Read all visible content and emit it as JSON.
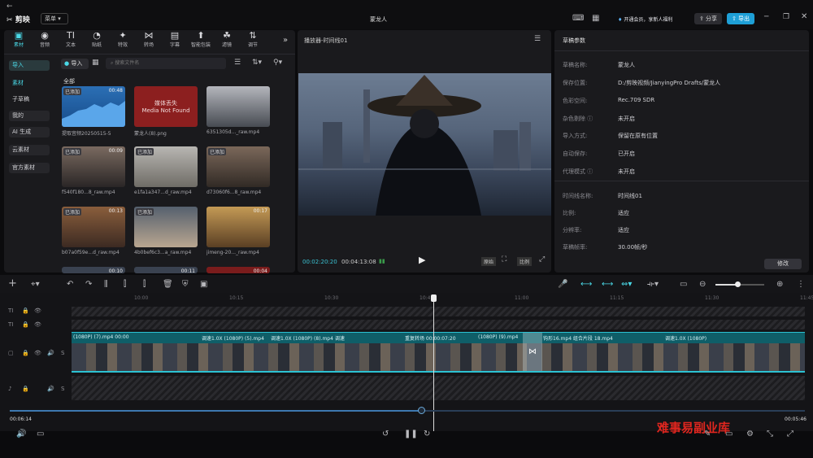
{
  "app": {
    "name": "剪映",
    "menu": "菜单",
    "project_title": "蒙龙人",
    "vip": "开通会员，享新人福利",
    "share": "分享",
    "export": "导出"
  },
  "toolbar": {
    "items": [
      {
        "label": "素材",
        "glyph": "▣"
      },
      {
        "label": "音频",
        "glyph": "◉"
      },
      {
        "label": "文本",
        "glyph": "TI"
      },
      {
        "label": "贴纸",
        "glyph": "◔"
      },
      {
        "label": "特效",
        "glyph": "✦"
      },
      {
        "label": "转场",
        "glyph": "⋈"
      },
      {
        "label": "字幕",
        "glyph": "▤"
      },
      {
        "label": "智能包装",
        "glyph": "⬆"
      },
      {
        "label": "滤镜",
        "glyph": "☘"
      },
      {
        "label": "调节",
        "glyph": "⇅"
      }
    ],
    "more": "»"
  },
  "sidebar": {
    "items": [
      "导入",
      "素材",
      "子草稿",
      "我的",
      "AI 生成",
      "云素材",
      "官方素材"
    ]
  },
  "media": {
    "import_label": "导入",
    "search_placeholder": "搜索文件名",
    "section": "全部",
    "items": [
      {
        "badge": "已添加",
        "dur": "00:48",
        "name": "提取音频20250515-5"
      },
      {
        "badge": "",
        "dur": "",
        "name": "蒙龙人(8).png",
        "missing_line1": "媒体丢失",
        "missing_line2": "Media Not Found"
      },
      {
        "badge": "",
        "dur": "",
        "name": "6351305d..._raw.mp4"
      },
      {
        "badge": "已添加",
        "dur": "00:09",
        "name": "f540f180...8_raw.mp4"
      },
      {
        "badge": "已添加",
        "dur": "",
        "name": "e1fa1a347...d_raw.mp4"
      },
      {
        "badge": "已添加",
        "dur": "",
        "name": "d73060f6...8_raw.mp4"
      },
      {
        "badge": "已添加",
        "dur": "00:13",
        "name": "b07a0f59e...d_raw.mp4"
      },
      {
        "badge": "已添加",
        "dur": "",
        "name": "4b0bef6c3...a_raw.mp4"
      },
      {
        "badge": "",
        "dur": "00:17",
        "name": "jimeng-20..._raw.mp4"
      },
      {
        "badge": "",
        "dur": "00:10",
        "name": ""
      },
      {
        "badge": "",
        "dur": "00:11",
        "name": ""
      },
      {
        "badge": "",
        "dur": "00:04",
        "name": ""
      }
    ]
  },
  "player": {
    "title": "播放器-时间线01",
    "current": "00:02:20:20",
    "total": "00:04:13:08",
    "ratio": "比例",
    "original": "原始"
  },
  "props": {
    "title": "草稿参数",
    "rows": [
      {
        "label": "草稿名称:",
        "value": "蒙龙人"
      },
      {
        "label": "保存位置:",
        "value": "D:/剪映视频/JianyingPro Drafts/蒙龙人"
      },
      {
        "label": "色彩空间:",
        "value": "Rec.709 SDR"
      },
      {
        "label": "杂色剔除 ⓘ",
        "value": "未开启"
      },
      {
        "label": "导入方式:",
        "value": "保留在原有位置"
      },
      {
        "label": "自动保存:",
        "value": "已开启"
      },
      {
        "label": "代理模式 ⓘ",
        "value": "未开启"
      },
      {
        "label": "时间线名称:",
        "value": "时间线01"
      },
      {
        "label": "比例:",
        "value": "适应"
      },
      {
        "label": "分辨率:",
        "value": "适应"
      },
      {
        "label": "草稿帧率:",
        "value": "30.00帧/秒"
      }
    ],
    "edit": "修改"
  },
  "timeline": {
    "ticks": [
      "10:00",
      "10:15",
      "10:30",
      "10:45",
      "11:00",
      "11:15",
      "11:30",
      "11:45"
    ],
    "clip_labels": [
      "(1080P)  (7).mp4  00:00",
      "调速1.0X  (1080P)  (5).mp4",
      "调速1.0X  (1080P)  (8).mp4  调速",
      "重复转场 00:00:07:20",
      "(1080P)  (9).mp4",
      "钩形16.mp4  组合片段 18.mp4",
      "调速1.0X  (1080P)"
    ],
    "start_time": "00:06:14",
    "end_time": "00:05:46",
    "playhead_value": 0.5,
    "scrub_value": 0.5
  },
  "watermark": "难事易副业库"
}
